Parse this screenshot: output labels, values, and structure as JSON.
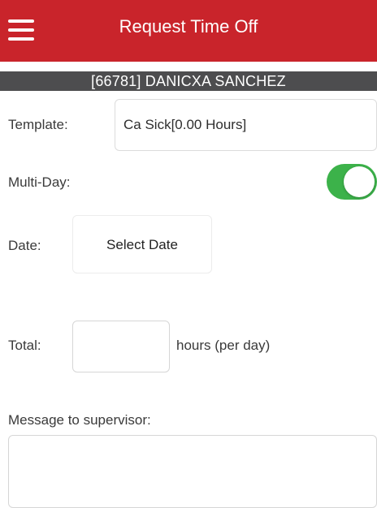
{
  "header": {
    "title": "Request Time Off",
    "menu_icon": "hamburger-menu-icon",
    "background_color": "#c9242b"
  },
  "employee": {
    "label": "[66781] DANICXA SANCHEZ"
  },
  "form": {
    "template_label": "Template:",
    "template_value": "Ca Sick[0.00 Hours]",
    "multiday_label": "Multi-Day:",
    "multiday_enabled": true,
    "toggle_color": "#3cb24a",
    "date_label": "Date:",
    "date_button": "Select Date",
    "total_label": "Total:",
    "total_value": "",
    "total_unit": "hours (per day)",
    "message_label": "Message to supervisor:",
    "message_value": ""
  }
}
